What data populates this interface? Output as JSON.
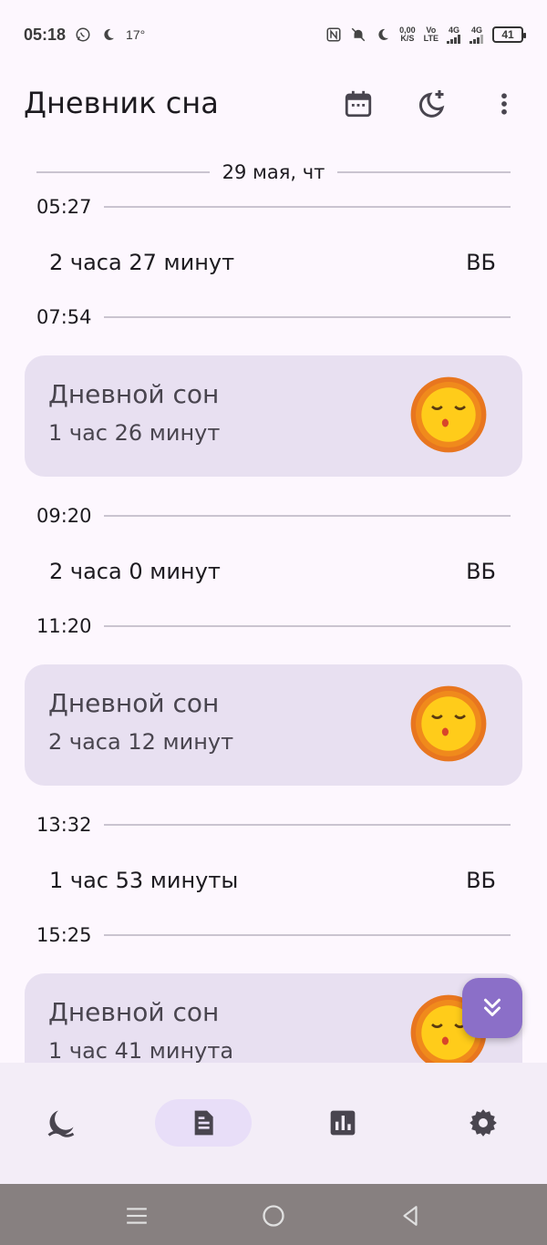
{
  "status_bar": {
    "time": "05:18",
    "temperature": "17°",
    "net_speed_value": "0,00",
    "net_speed_unit": "K/S",
    "volte_top": "Vo",
    "volte_bottom": "LTE",
    "signal1": "4G",
    "signal2": "4G",
    "battery": "41"
  },
  "app_bar": {
    "title": "Дневник сна",
    "icons": [
      "calendar-icon",
      "moon-plus-icon",
      "more-vert-icon"
    ]
  },
  "timeline": {
    "date_label": "29 мая, чт",
    "entries": [
      {
        "type": "time",
        "value": "05:27"
      },
      {
        "type": "wake",
        "duration": "2 часа 27 минут",
        "tag": "ВБ"
      },
      {
        "type": "time",
        "value": "07:54"
      },
      {
        "type": "sleep",
        "name": "Дневной сон",
        "duration": "1 час 26 минут"
      },
      {
        "type": "time",
        "value": "09:20"
      },
      {
        "type": "wake",
        "duration": "2 часа 0 минут",
        "tag": "ВБ"
      },
      {
        "type": "time",
        "value": "11:20"
      },
      {
        "type": "sleep",
        "name": "Дневной сон",
        "duration": "2 часа 12 минут"
      },
      {
        "type": "time",
        "value": "13:32"
      },
      {
        "type": "wake",
        "duration": "1 час 53 минуты",
        "tag": "ВБ"
      },
      {
        "type": "time",
        "value": "15:25"
      },
      {
        "type": "sleep",
        "name": "Дневной сон",
        "duration": "1 час 41 минута"
      }
    ]
  },
  "bottom_nav": {
    "items": [
      "sleep-moon-icon",
      "diary-icon",
      "stats-icon",
      "settings-icon"
    ],
    "active": "diary-icon"
  },
  "colors": {
    "background": "#fdf7fe",
    "card": "#e8e0f1",
    "fab": "#8b6fc8",
    "nav_active": "#e8def8",
    "divider": "#cac4d0"
  }
}
